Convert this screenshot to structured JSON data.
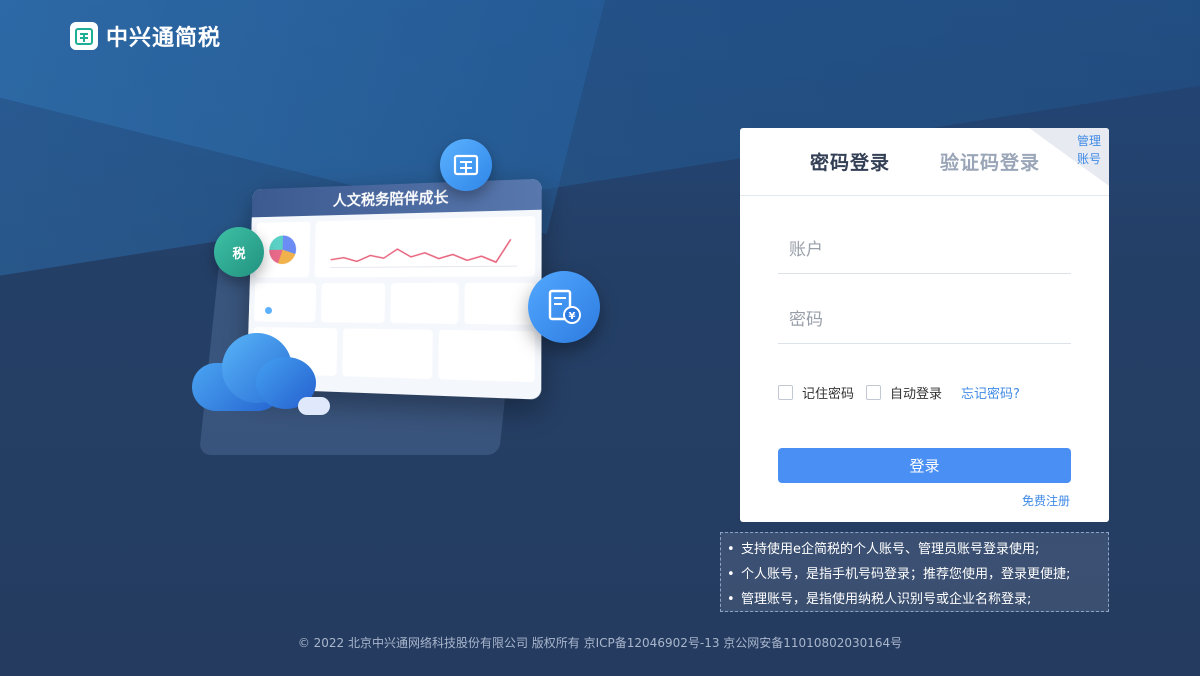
{
  "brand": {
    "name": "中兴通简税",
    "logo_icon": "document-grid-icon"
  },
  "illustration": {
    "panel_title": "人文税务陪伴成长",
    "badge_tax": "税"
  },
  "login": {
    "tabs": [
      "密码登录",
      "验证码登录"
    ],
    "active_tab": "密码登录",
    "corner_label": "管理账号",
    "account_placeholder": "账户",
    "password_placeholder": "密码",
    "remember_label": "记住密码",
    "auto_login_label": "自动登录",
    "forgot_label": "忘记密码?",
    "submit_label": "登录",
    "register_label": "免费注册"
  },
  "notes": [
    "支持使用e企简税的个人账号、管理员账号登录使用;",
    "个人账号，是指手机号码登录；推荐您使用，登录更便捷;",
    "管理账号，是指使用纳税人识别号或企业名称登录;"
  ],
  "footer": "© 2022 北京中兴通网络科技股份有限公司 版权所有 京ICP备12046902号-13 京公网安备11010802030164号",
  "colors": {
    "accent": "#4a8ff4",
    "link": "#3f8ae6",
    "background": "#233f66"
  }
}
